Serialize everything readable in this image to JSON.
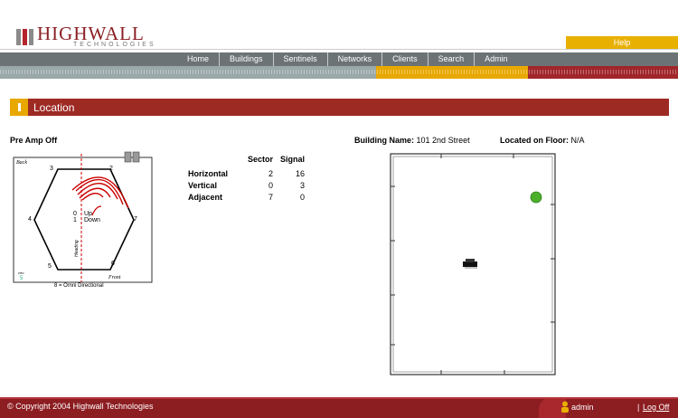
{
  "header": {
    "logo_main": "HIGHWALL",
    "logo_sub": "TECHNOLOGIES",
    "help_label": "Help"
  },
  "nav": {
    "items": [
      "Home",
      "Buildings",
      "Sentinels",
      "Networks",
      "Clients",
      "Search",
      "Admin"
    ]
  },
  "section": {
    "title": "Location"
  },
  "sentinel": {
    "preamp_status": "Pre Amp Off",
    "diagram": {
      "corner_back": "Back",
      "corner_front": "Front",
      "heading_label": "Heading",
      "sectors": [
        "0",
        "1",
        "2",
        "3",
        "4",
        "5",
        "6",
        "7"
      ],
      "center_up": "Up",
      "center_down": "Down",
      "left_bottom_label": "ceo",
      "left_bottom_value": "5",
      "caption": "8 = Omni Directional"
    }
  },
  "signal_table": {
    "headers": [
      "",
      "Sector",
      "Signal"
    ],
    "rows": [
      {
        "label": "Horizontal",
        "sector": "2",
        "signal": "16"
      },
      {
        "label": "Vertical",
        "sector": "0",
        "signal": "3"
      },
      {
        "label": "Adjacent",
        "sector": "7",
        "signal": "0"
      }
    ]
  },
  "building": {
    "name_label": "Building Name:",
    "name_value": "101 2nd Street",
    "floor_label": "Located on Floor:",
    "floor_value": "N/A"
  },
  "colors": {
    "brand_red": "#9e2a24",
    "accent_yellow": "#e8a800",
    "nav_gray": "#6c7375",
    "marker_green": "#4caf2a"
  },
  "footer": {
    "copyright": "© Copyright 2004 Highwall Technologies",
    "user": "admin",
    "separator": "|",
    "logoff": "Log Off"
  }
}
